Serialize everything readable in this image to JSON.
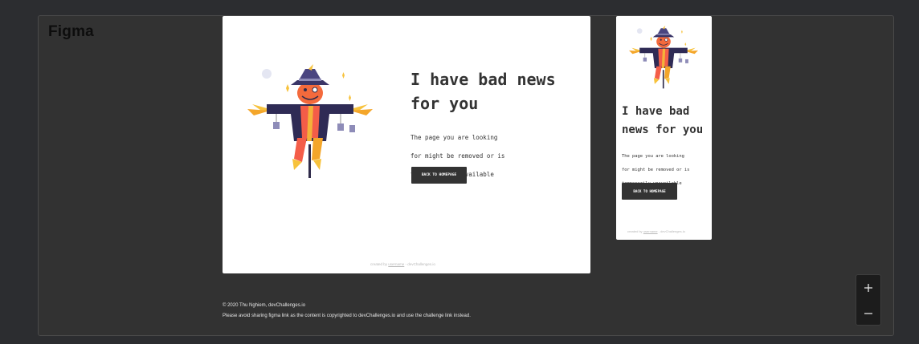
{
  "viewer": {
    "brand": "Figma",
    "zoom_in_icon": "plus-icon",
    "zoom_out_icon": "minus-icon"
  },
  "desktop": {
    "heading_line1": "I have bad news",
    "heading_line2": "for you",
    "body_line1": "The page you are looking",
    "body_line2": "for might be removed or is",
    "body_line3": "temporarily unavailable",
    "button_label": "BACK TO HOMEPAGE",
    "credit_prefix": "created by",
    "credit_user": "username",
    "credit_suffix": "- devChallenges.io"
  },
  "mobile": {
    "heading_line1": "I have bad",
    "heading_line2": "news for you",
    "body_line1": "The page you are looking",
    "body_line2": "for might be removed or is",
    "body_line3": "temporarily unavailable",
    "button_label": "BACK TO HOMEPAGE",
    "credit_prefix": "created by",
    "credit_user": "username",
    "credit_suffix": "- devChallenges.io"
  },
  "footer": {
    "copyright": "© 2020 Thu Nghiem, devChallenges.io",
    "notice": "Please avoid sharing figma link as the content is copyrighted to devChallenges.io and use the challenge link instead."
  },
  "colors": {
    "canvas": "#2c2d30",
    "viewer": "#323232",
    "frame": "#ffffff",
    "text": "#333333",
    "button": "#333333"
  }
}
